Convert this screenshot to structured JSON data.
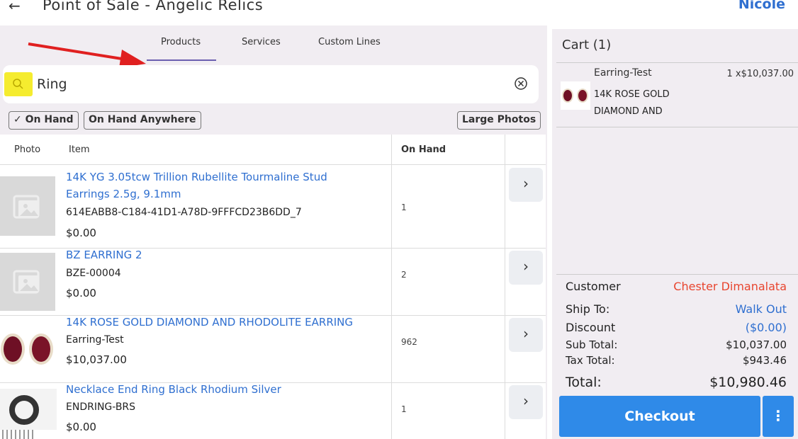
{
  "header": {
    "back_icon": "←",
    "title": "Point of Sale - Angelic Relics",
    "user": "Nicole"
  },
  "tabs": [
    {
      "label": "Products"
    },
    {
      "label": "Services"
    },
    {
      "label": "Custom Lines"
    }
  ],
  "search": {
    "value": "Ring",
    "placeholder": ""
  },
  "filters": {
    "on_hand": "On Hand",
    "on_hand_anywhere": "On Hand Anywhere",
    "large_photos": "Large Photos",
    "check_glyph": "✓"
  },
  "table": {
    "headers": {
      "photo": "Photo",
      "item": "Item",
      "on_hand": "On Hand"
    },
    "rows": [
      {
        "name_line1": "14K YG 3.05tcw Trillion Rubellite Tourmaline Stud",
        "name_line2": "Earrings 2.5g, 9.1mm",
        "sku": "614EABB8-C184-41D1-A78D-9FFFCD23B6DD_7",
        "price": "$0.00",
        "on_hand": "1"
      },
      {
        "name_line1": "BZ EARRING 2",
        "sku": "BZE-00004",
        "price": "$0.00",
        "on_hand": "2"
      },
      {
        "name_line1": "14K ROSE GOLD DIAMOND AND RHODOLITE EARRING",
        "sku": "Earring-Test",
        "price": "$10,037.00",
        "on_hand": "962"
      },
      {
        "name_line1": "Necklace End Ring Black Rhodium Silver",
        "sku": "ENDRING-BRS",
        "price": "$0.00",
        "on_hand": "1"
      }
    ]
  },
  "cart": {
    "title": "Cart (1)",
    "item": {
      "name": "Earring-Test",
      "qty_price": "1 x$10,037.00",
      "desc_line1": "14K ROSE GOLD",
      "desc_line2": "DIAMOND AND"
    },
    "summary": {
      "customer_label": "Customer",
      "customer_value": "Chester Dimanalata",
      "ship_label": "Ship To:",
      "ship_value": "Walk Out",
      "discount_label": "Discount",
      "discount_value": "($0.00)",
      "subtotal_label": "Sub Total:",
      "subtotal_value": "$10,037.00",
      "tax_label": "Tax Total:",
      "tax_value": "$943.46",
      "total_label": "Total:",
      "total_value": "$10,980.46"
    },
    "checkout_label": "Checkout",
    "more_label": "⋮"
  },
  "colors": {
    "accent": "#2f8ae8",
    "link": "#2f6fd0",
    "customer": "#e8452f",
    "highlight": "#f5ec2f",
    "annotation_arrow": "#e02020"
  }
}
